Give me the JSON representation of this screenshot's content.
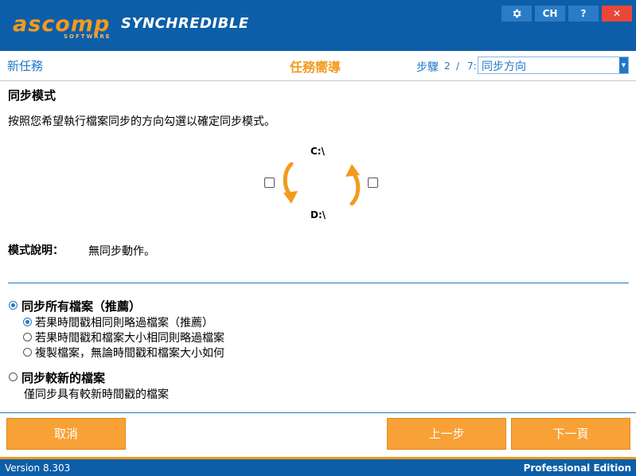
{
  "titlebar": {
    "logo_text": "ascomp",
    "logo_sub": "SOFTWARE",
    "app_name": "SYNCHREDIBLE",
    "settings_icon": "gear-icon",
    "language": "CH",
    "help": "?",
    "close": "✕"
  },
  "nav": {
    "new_task": "新任務",
    "wizard_title": "任務嚮導",
    "step_label": "步驟",
    "step_current": "2",
    "step_sep": "/",
    "step_total": "7:",
    "step_selected": "同步方向"
  },
  "content": {
    "section_title": "同步模式",
    "instruction": "按照您希望執行檔案同步的方向勾選以確定同步模式。",
    "drive_top": "C:\\",
    "drive_bottom": "D:\\",
    "mode_label": "模式說明：",
    "mode_value": "無同步動作。"
  },
  "options": {
    "sync_all": "同步所有檔案（推薦）",
    "skip_same_time": "若果時間戳相同則略過檔案（推薦）",
    "skip_same_time_size": "若果時間戳和檔案大小相同則略過檔案",
    "copy_always": "複製檔案，無論時間戳和檔案大小如何",
    "sync_newer": "同步較新的檔案",
    "sync_newer_desc": "僅同步具有較新時間戳的檔案"
  },
  "buttons": {
    "cancel": "取消",
    "back": "上一步",
    "next": "下一頁"
  },
  "status": {
    "version": "Version 8.303",
    "edition": "Professional Edition"
  },
  "colors": {
    "brand_blue": "#0d5ea8",
    "accent_orange": "#f39a1e"
  }
}
